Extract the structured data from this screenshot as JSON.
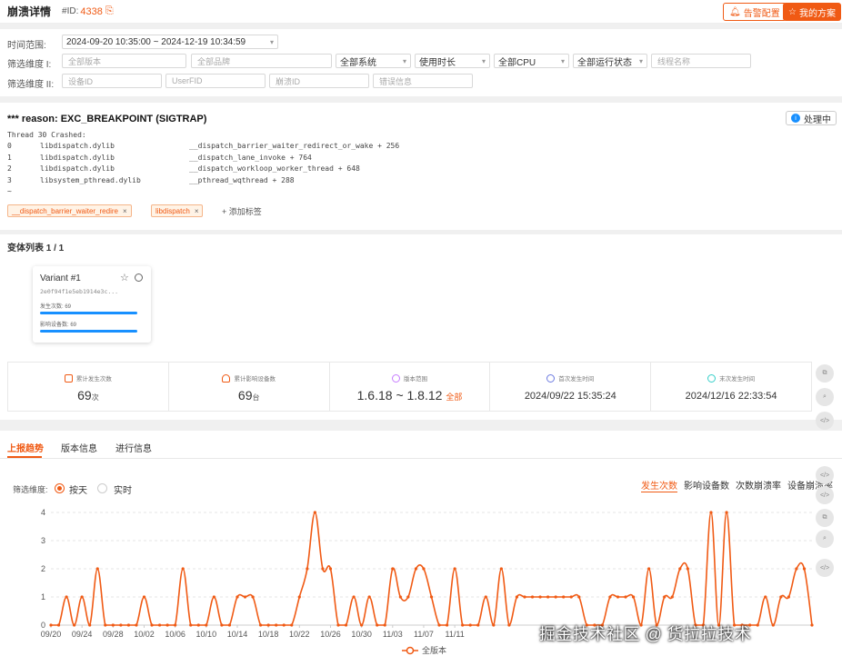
{
  "header": {
    "title": "崩溃详情",
    "id_label": "#ID:",
    "id_value": "4338",
    "alarm_btn": "告警配置",
    "plan_btn": "我的方案"
  },
  "filters": {
    "time_label": "时间范围:",
    "time_value": "2024-09-20 10:35:00 ~ 2024-12-19 10:34:59",
    "dim1_label": "筛选维度 I:",
    "version_placeholder": "全部版本",
    "brand_placeholder": "全部品牌",
    "system": "全部系统",
    "duration": "使用时长",
    "cpu": "全部CPU",
    "run_state": "全部运行状态",
    "thread_placeholder": "线程名称",
    "dim2_label": "筛选维度 II:",
    "device_placeholder": "设备ID",
    "user_placeholder": "UserFID",
    "crash_placeholder": "崩溃ID",
    "error_placeholder": "错误信息"
  },
  "stack": {
    "reason": "*** reason: EXC_BREAKPOINT (SIGTRAP)",
    "thread": "Thread 30 Crashed:",
    "frames": [
      {
        "idx": "0",
        "lib": "libdispatch.dylib",
        "sym": "__dispatch_barrier_waiter_redirect_or_wake + 256"
      },
      {
        "idx": "1",
        "lib": "libdispatch.dylib",
        "sym": "__dispatch_lane_invoke + 764"
      },
      {
        "idx": "2",
        "lib": "libdispatch.dylib",
        "sym": "__dispatch_workloop_worker_thread + 648"
      },
      {
        "idx": "3",
        "lib": "libsystem_pthread.dylib",
        "sym": "__pthread_wqthread + 288"
      }
    ],
    "ellipsis": "~",
    "tags": [
      "__dispatch_barrier_waiter_redire",
      "libdispatch"
    ],
    "add_tag": "+ 添加标签",
    "process_btn": "处理中"
  },
  "variants": {
    "title": "变体列表 1 / 1",
    "card": {
      "name": "Variant #1",
      "hash": "2e0f94f1e5eb1914e3c...",
      "count_label": "发生次数: 69",
      "device_label": "影响设备数: 69"
    }
  },
  "stats": [
    {
      "label": "累计发生次数",
      "value": "69",
      "unit": "次",
      "color": "#f05a14"
    },
    {
      "label": "累计影响设备数",
      "value": "69",
      "unit": "台",
      "color": "#f05a14"
    },
    {
      "label": "版本范围",
      "value": "1.6.18 ~ 1.8.12",
      "unit": "全部",
      "color": "#c77dff"
    },
    {
      "label": "首次发生时间",
      "value": "2024/09/22 15:35:24",
      "unit": "",
      "color": "#6c7ae0"
    },
    {
      "label": "末次发生时间",
      "value": "2024/12/16 22:33:54",
      "unit": "",
      "color": "#36cfc9"
    }
  ],
  "trend": {
    "tabs": [
      "上报趋势",
      "版本信息",
      "进行信息"
    ],
    "dim_label": "筛选维度:",
    "radio_day": "按天",
    "radio_realtime": "实时",
    "metrics": [
      "发生次数",
      "影响设备数",
      "次数崩溃率",
      "设备崩溃率"
    ]
  },
  "chart_data": {
    "type": "line",
    "title": "",
    "xlabel": "",
    "ylabel": "",
    "ylim": [
      0,
      4
    ],
    "yticks": [
      0,
      1,
      2,
      3,
      4
    ],
    "grid": true,
    "legend_position": "bottom",
    "x_tick_labels": [
      "09/20",
      "09/24",
      "09/28",
      "10/02",
      "10/06",
      "10/10",
      "10/14",
      "10/18",
      "10/22",
      "10/26",
      "10/30",
      "11/03",
      "11/07",
      "11/11"
    ],
    "series": [
      {
        "name": "全版本",
        "color": "#f05a14",
        "values": [
          0,
          0,
          1,
          0,
          1,
          0,
          2,
          0,
          0,
          0,
          0,
          0,
          1,
          0,
          0,
          0,
          0,
          2,
          0,
          0,
          0,
          1,
          0,
          0,
          1,
          1,
          1,
          0,
          0,
          0,
          0,
          0,
          1,
          2,
          4,
          2,
          2,
          0,
          0,
          1,
          0,
          1,
          0,
          0,
          2,
          1,
          1,
          2,
          2,
          1,
          0,
          0,
          2,
          0,
          0,
          0,
          1,
          0,
          2,
          0,
          1,
          1,
          1,
          1,
          1,
          1,
          1,
          1,
          1,
          0,
          0,
          0,
          1,
          1,
          1,
          1,
          0,
          2,
          0,
          1,
          1,
          2,
          2,
          0,
          0,
          4,
          0,
          4,
          0,
          0,
          0,
          0,
          1,
          0,
          1,
          1,
          2,
          2,
          0
        ]
      }
    ]
  },
  "watermark": "掘金技术社区 @ 货拉拉技术"
}
